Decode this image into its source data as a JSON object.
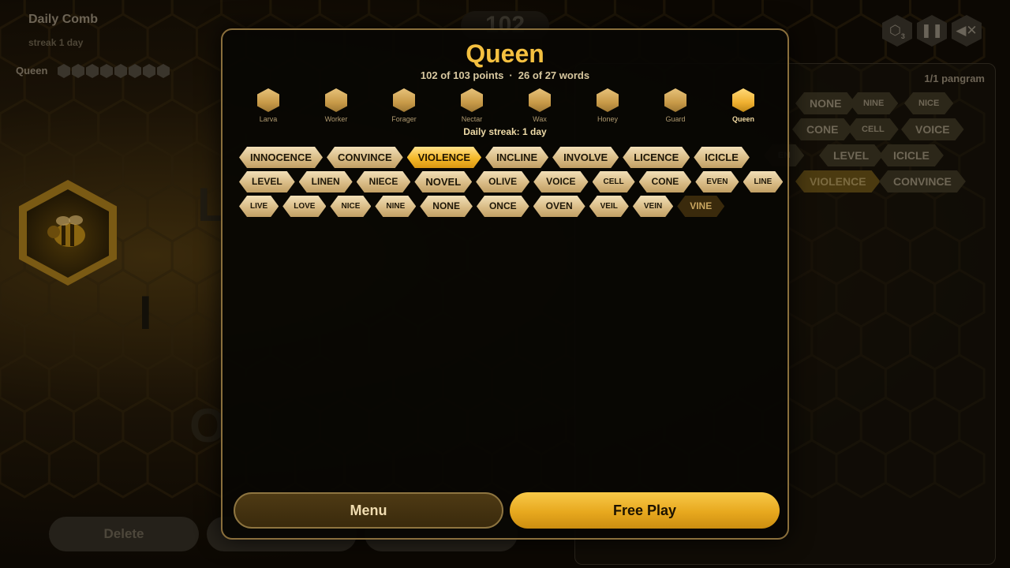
{
  "background": {
    "game_title": "Daily Comb",
    "streak_text": "streak 1 day",
    "rank_label": "Queen",
    "score": "102",
    "hint_count": "3",
    "hint_icon": "hexagon-hint-icon",
    "pause_icon": "pause-icon",
    "mute_icon": "speaker-muted-icon",
    "pangram_text": "1/1 pangram",
    "letters": [
      "L",
      "I",
      "O"
    ],
    "delete_label": "Delete",
    "found_words": [
      {
        "text": "NONE",
        "size": "normal",
        "hot": false
      },
      {
        "text": "NINE",
        "size": "small",
        "hot": false
      },
      {
        "text": "NICE",
        "size": "small",
        "hot": false
      },
      {
        "text": "CONE",
        "size": "normal",
        "hot": false
      },
      {
        "text": "CELL",
        "size": "small",
        "hot": false
      },
      {
        "text": "VOICE",
        "size": "normal",
        "hot": false
      },
      {
        "text": "EN",
        "size": "small",
        "hot": false
      },
      {
        "text": "LEVEL",
        "size": "normal",
        "hot": false
      },
      {
        "text": "ICICLE",
        "size": "normal",
        "hot": false
      },
      {
        "text": "VIOLENCE",
        "size": "normal",
        "hot": true
      },
      {
        "text": "CONVINCE",
        "size": "normal",
        "hot": false
      }
    ]
  },
  "modal": {
    "title": "Queen",
    "points_text": "102 of 103 points",
    "separator": "·",
    "words_text": "26 of 27 words",
    "streak_text": "Daily streak: 1 day",
    "ranks": [
      {
        "label": "Larva",
        "current": false
      },
      {
        "label": "Worker",
        "current": false
      },
      {
        "label": "Forager",
        "current": false
      },
      {
        "label": "Nectar",
        "current": false
      },
      {
        "label": "Wax",
        "current": false
      },
      {
        "label": "Honey",
        "current": false
      },
      {
        "label": "Guard",
        "current": false
      },
      {
        "label": "Queen",
        "current": true
      }
    ],
    "word_rows": [
      [
        {
          "text": "INNOCENCE",
          "type": "found",
          "size": "normal"
        },
        {
          "text": "CONVINCE",
          "type": "found",
          "size": "normal"
        },
        {
          "text": "VIOLENCE",
          "type": "pangram",
          "size": "normal"
        },
        {
          "text": "INCLINE",
          "type": "found",
          "size": "normal"
        },
        {
          "text": "INVOLVE",
          "type": "found",
          "size": "normal"
        },
        {
          "text": "LICENCE",
          "type": "found",
          "size": "normal"
        },
        {
          "text": "ICICLE",
          "type": "found",
          "size": "normal"
        }
      ],
      [
        {
          "text": "LEVEL",
          "type": "found",
          "size": "sm"
        },
        {
          "text": "LINEN",
          "type": "found",
          "size": "sm"
        },
        {
          "text": "NIECE",
          "type": "found",
          "size": "sm"
        },
        {
          "text": "NOVEL",
          "type": "found",
          "size": "normal"
        },
        {
          "text": "OLIVE",
          "type": "found",
          "size": "sm"
        },
        {
          "text": "VOICE",
          "type": "found",
          "size": "sm"
        },
        {
          "text": "CELL",
          "type": "found",
          "size": "xs"
        },
        {
          "text": "CONE",
          "type": "found",
          "size": "sm"
        },
        {
          "text": "EVEN",
          "type": "found",
          "size": "xs"
        },
        {
          "text": "LINE",
          "type": "found",
          "size": "xs"
        }
      ],
      [
        {
          "text": "LIVE",
          "type": "found",
          "size": "xs"
        },
        {
          "text": "LOVE",
          "type": "found",
          "size": "xs"
        },
        {
          "text": "NICE",
          "type": "found",
          "size": "xs"
        },
        {
          "text": "NINE",
          "type": "found",
          "size": "xs"
        },
        {
          "text": "NONE",
          "type": "found",
          "size": "sm"
        },
        {
          "text": "ONCE",
          "type": "found",
          "size": "sm"
        },
        {
          "text": "OVEN",
          "type": "found",
          "size": "sm"
        },
        {
          "text": "VEIL",
          "type": "found",
          "size": "xs"
        },
        {
          "text": "VEIN",
          "type": "found",
          "size": "xs"
        },
        {
          "text": "VINE",
          "type": "missing",
          "size": "sm"
        }
      ]
    ],
    "menu_label": "Menu",
    "free_play_label": "Free Play"
  }
}
